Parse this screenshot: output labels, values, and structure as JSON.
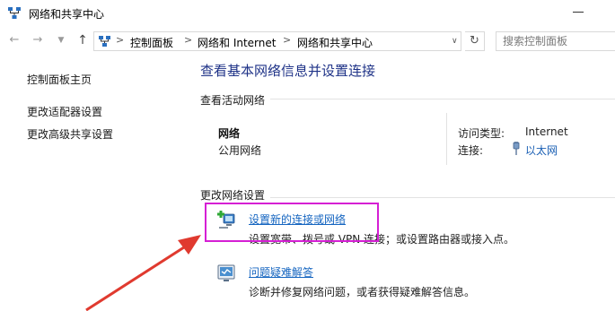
{
  "window": {
    "title": "网络和共享中心"
  },
  "address": {
    "crumbs": [
      "控制面板",
      "网络和 Internet",
      "网络和共享中心"
    ],
    "separator": ">"
  },
  "search": {
    "placeholder": "搜索控制面板"
  },
  "sidebar": {
    "items": [
      {
        "label": "控制面板主页"
      },
      {
        "label": "更改适配器设置"
      },
      {
        "label": "更改高级共享设置"
      }
    ]
  },
  "main": {
    "title": "查看基本网络信息并设置连接",
    "active_section": "查看活动网络",
    "network": {
      "name": "网络",
      "category": "公用网络",
      "access_label": "访问类型:",
      "access_value": "Internet",
      "connection_label": "连接:",
      "connection_value": "以太网"
    },
    "change_section": "更改网络设置",
    "tasks": [
      {
        "icon": "new-connection-icon",
        "link": "设置新的连接或网络",
        "desc": "设置宽带、拨号或 VPN 连接；或设置路由器或接入点。"
      },
      {
        "icon": "troubleshoot-icon",
        "link": "问题疑难解答",
        "desc": "诊断并修复网络问题，或者获得疑难解答信息。"
      }
    ]
  },
  "annotation": {
    "highlight_color": "#d51fd4",
    "arrow_color": "#e03a2f"
  }
}
